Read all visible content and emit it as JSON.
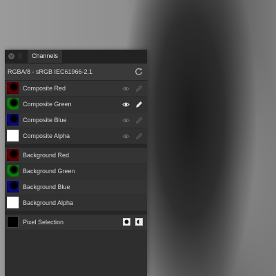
{
  "panel": {
    "tab_label": "Channels",
    "format_text": "RGBA/8 - sRGB IEC61966-2.1"
  },
  "composite_channels": [
    {
      "label": "Composite Red",
      "thumb": "red",
      "visible_active": false
    },
    {
      "label": "Composite Green",
      "thumb": "green",
      "visible_active": true
    },
    {
      "label": "Composite Blue",
      "thumb": "blue",
      "visible_active": false
    },
    {
      "label": "Composite Alpha",
      "thumb": "white",
      "visible_active": false
    }
  ],
  "background_channels": [
    {
      "label": "Background Red",
      "thumb": "red"
    },
    {
      "label": "Background Green",
      "thumb": "green"
    },
    {
      "label": "Background Blue",
      "thumb": "blue"
    },
    {
      "label": "Background Alpha",
      "thumb": "white"
    }
  ],
  "selection": {
    "label": "Pixel Selection"
  },
  "colors": {
    "panel_bg": "#2e2e2e",
    "active_icon": "#e8e8e8",
    "inactive_icon": "#6a6a6a"
  },
  "icons": {
    "close": "close-icon",
    "reset": "reset-icon",
    "visibility": "eye-icon",
    "edit": "pencil-icon",
    "load_selection": "circle-selection-icon",
    "mask_selection": "mask-selection-icon"
  }
}
